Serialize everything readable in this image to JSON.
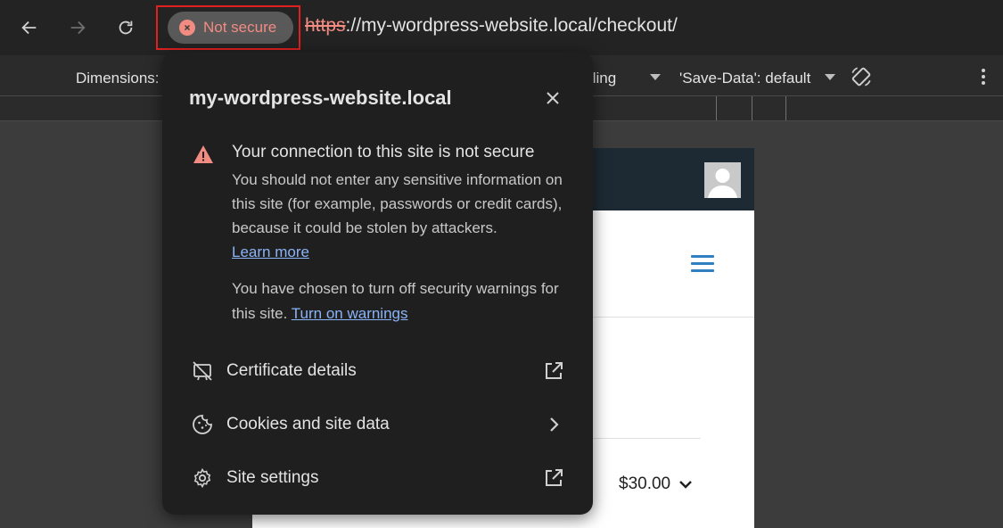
{
  "browser": {
    "security_chip": {
      "label": "Not secure",
      "color": "#f28b82"
    },
    "url": {
      "scheme": "https",
      "rest": "://my-wordpress-website.local/checkout/"
    }
  },
  "devtools": {
    "dimensions_label": "Dimensions:",
    "throttling_label": "tling",
    "save_data_label": "'Save-Data': default"
  },
  "page": {
    "price": "$30.00"
  },
  "popup": {
    "title": "my-wordpress-website.local",
    "warning": {
      "title": "Your connection to this site is not secure",
      "body": "You should not enter any sensitive information on this site (for example, passwords or credit cards), because it could be stolen by attackers.",
      "learn_more": "Learn more",
      "chosen": "You have chosen to turn off security warnings for this site.",
      "turn_on": "Turn on warnings"
    },
    "items": [
      {
        "label": "Certificate details",
        "icon": "certificate-off-icon",
        "action_icon": "external-link-icon"
      },
      {
        "label": "Cookies and site data",
        "icon": "cookie-icon",
        "action_icon": "chevron-right-icon"
      },
      {
        "label": "Site settings",
        "icon": "gear-icon",
        "action_icon": "external-link-icon"
      }
    ]
  },
  "colors": {
    "accent_warning": "#f28b82",
    "link": "#8ab4f8",
    "popup_bg": "#1f1f1f"
  }
}
